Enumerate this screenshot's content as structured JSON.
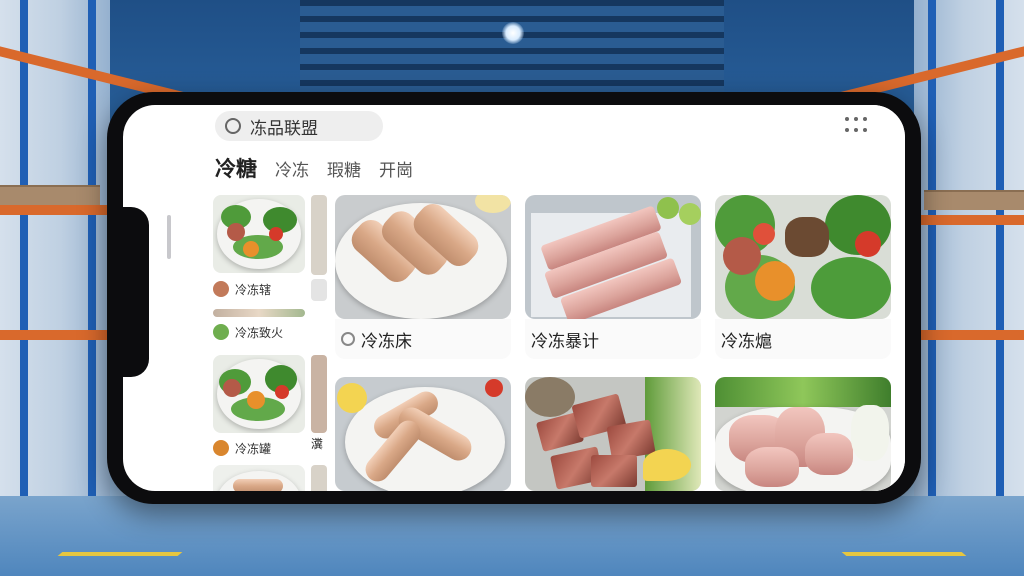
{
  "app": {
    "title": "冻品联盟",
    "logo_icon": "app-logo-icon",
    "menu_icon": "more-dots-icon"
  },
  "tabs": [
    {
      "label": "冷糖",
      "active": true
    },
    {
      "label": "冷冻",
      "active": false
    },
    {
      "label": "瑕糖",
      "active": false
    },
    {
      "label": "开崗",
      "active": false
    }
  ],
  "sidebar": {
    "items": [
      {
        "label": "冷冻辖"
      },
      {
        "label": "冷冻致火"
      },
      {
        "label": "冷冻罐"
      }
    ],
    "peek_label": "瀵"
  },
  "products": [
    {
      "caption": "冷冻床"
    },
    {
      "caption": "冷冻暴计"
    },
    {
      "caption": "冷冻熩"
    },
    {
      "caption": ""
    },
    {
      "caption": ""
    },
    {
      "caption": ""
    }
  ],
  "colors": {
    "accent": "#222222",
    "background": "#ffffff",
    "backdrop_blue": "#2e6aa8",
    "rack_orange": "#d9692c"
  }
}
